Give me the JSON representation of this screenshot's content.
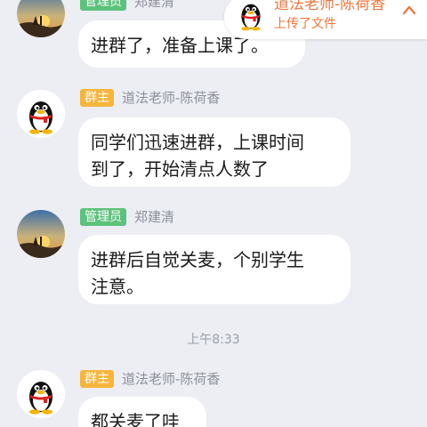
{
  "messages": [
    {
      "role_badge": "管理员",
      "sender": "郑建清",
      "lines": [
        "进群了，准备上课了。"
      ],
      "avatar_icon": "sunset-photo-avatar"
    },
    {
      "role_badge": "群主",
      "sender": "道法老师-陈荷香",
      "lines": [
        "同学们迅速进群，上课时间",
        "到了，开始清点人数了"
      ],
      "avatar_icon": "penguin-avatar"
    },
    {
      "role_badge": "管理员",
      "sender": "郑建清",
      "lines": [
        "进群后自觉关麦，个别学生",
        "注意。"
      ],
      "avatar_icon": "sunset-photo-avatar"
    },
    {
      "role_badge": "群主",
      "sender": "道法老师-陈荷香",
      "lines": [
        "都关麦了哇"
      ],
      "avatar_icon": "penguin-avatar"
    }
  ],
  "timestamp": "上午8:33",
  "notice": {
    "title": "道法老师-陈荷香",
    "subtitle": "上传了文件",
    "avatar_icon": "penguin-avatar",
    "collapse_icon": "chevron-up-icon"
  },
  "colors": {
    "background": "#eceef4",
    "owner_badge": "#f6b53b",
    "admin_badge": "#5dc27b",
    "notice_text": "#f1743a",
    "bubble": "#ffffff"
  }
}
